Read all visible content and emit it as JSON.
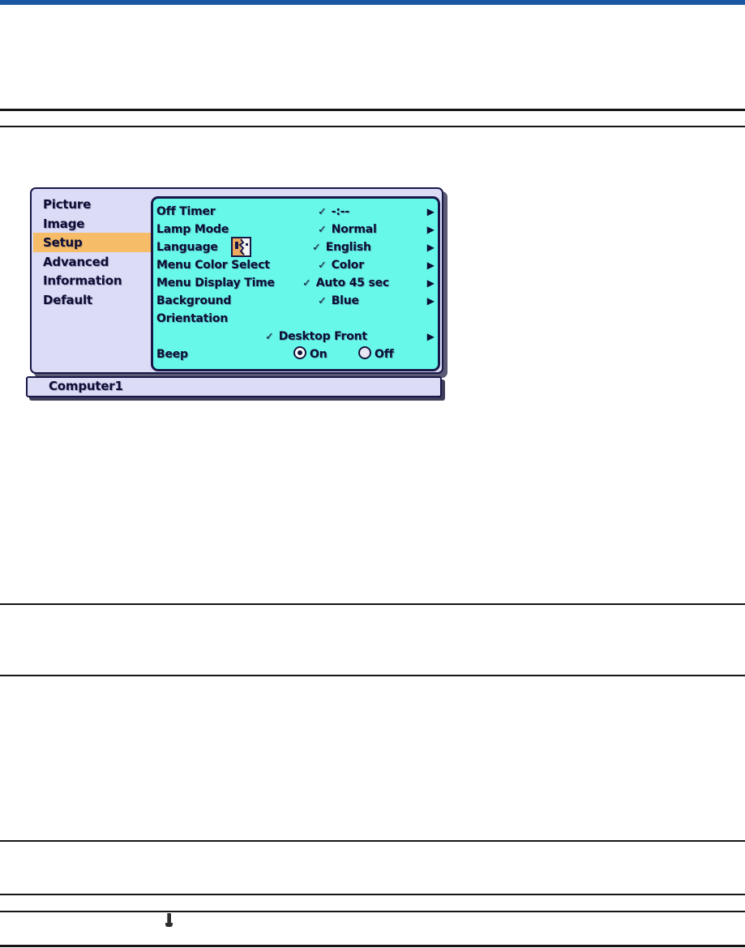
{
  "page": {
    "top_bar_color": "#1A57A5",
    "rule_color": "#151515"
  },
  "menu": {
    "sidebar_items": [
      "Picture",
      "Image",
      "Setup",
      "Advanced",
      "Information",
      "Default"
    ],
    "selected_item": "Setup",
    "rows": [
      {
        "label": "Off Timer",
        "value": "-:--"
      },
      {
        "label": "Lamp Mode",
        "value": "Normal"
      },
      {
        "label": "Language",
        "value": "English"
      },
      {
        "label": "Menu Color Select",
        "value": "Color"
      },
      {
        "label": "Menu Display Time",
        "value": "Auto 45 sec"
      },
      {
        "label": "Background",
        "value": "Blue"
      },
      {
        "label": "Orientation",
        "value": ""
      },
      {
        "label": "",
        "value": "Desktop Front"
      },
      {
        "label": "Beep",
        "on_label": "On",
        "off_label": "Off",
        "selected": "On"
      }
    ],
    "glyphs": {
      "check": "✓",
      "arrow": "▶"
    },
    "icons": {
      "language_icon": "language-select-card",
      "pin_icon": "pin-marker"
    },
    "source": "Computer1",
    "colors": {
      "panel_cyan": "#68F8E9",
      "sidebar_lavender": "#DCDCF7",
      "highlight_orange": "#F6BC67",
      "border_navy": "#181848",
      "shadow": "#5a5a74",
      "text": "#0d0d35"
    }
  }
}
